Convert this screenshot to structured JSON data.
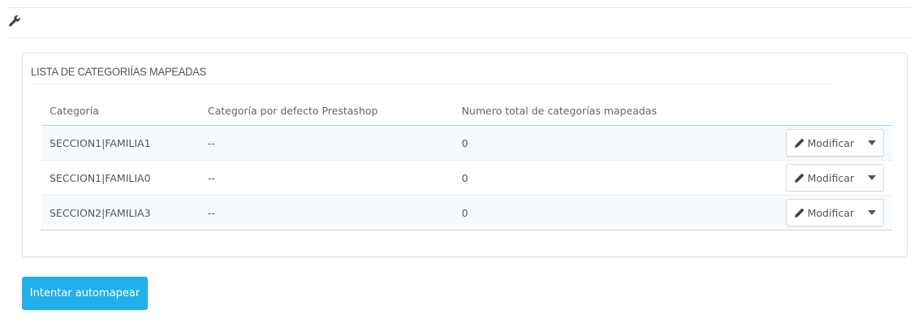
{
  "panel": {
    "title": "LISTA DE CATEGORIÍAS MAPEADAS"
  },
  "table": {
    "headers": [
      "Categoría",
      "Categoría por defecto Prestashop",
      "Numero total de categorías mapeadas"
    ],
    "rows": [
      {
        "categoria": "SECCION1|FAMILIA1",
        "defecto": "--",
        "total": "0",
        "action": "Modificar"
      },
      {
        "categoria": "SECCION1|FAMILIA0",
        "defecto": "--",
        "total": "0",
        "action": "Modificar"
      },
      {
        "categoria": "SECCION2|FAMILIA3",
        "defecto": "--",
        "total": "0",
        "action": "Modificar"
      }
    ]
  },
  "actions": {
    "automap_label": "Intentar automapear"
  },
  "icons": {
    "toolbar": "wrench-icon",
    "edit": "pencil-icon",
    "dropdown": "caret-down-icon"
  },
  "colors": {
    "primary": "#21b0e9",
    "header_rule": "#a8d5ec"
  }
}
